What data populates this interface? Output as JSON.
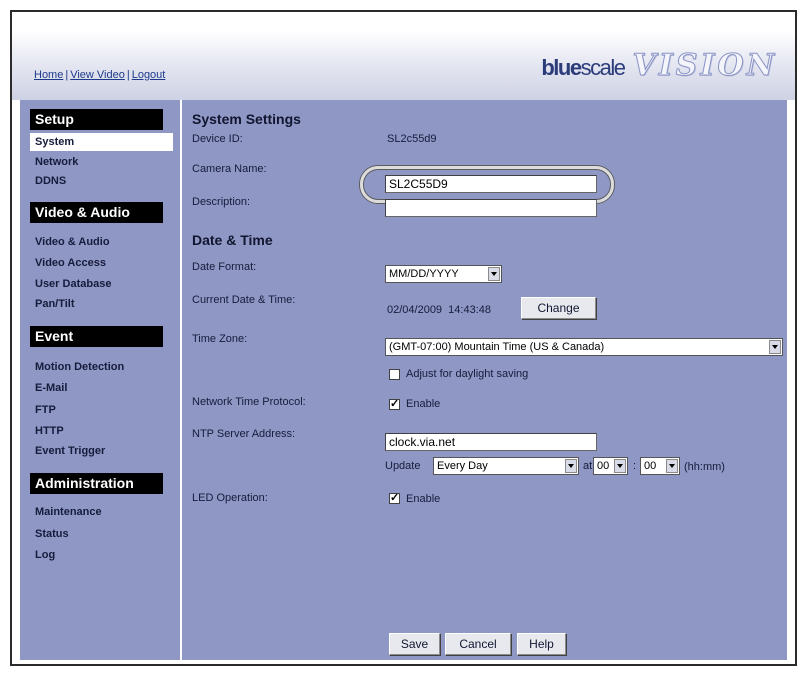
{
  "header": {
    "links": [
      "Home",
      "View Video",
      "Logout"
    ],
    "separator": "|",
    "logo": {
      "brand_bold": "blue",
      "brand_rest": "scale",
      "product": "VISION"
    }
  },
  "sidebar": {
    "sections": [
      {
        "title": "Setup",
        "items": [
          "System",
          "Network",
          "DDNS"
        ]
      },
      {
        "title": "Video & Audio",
        "items": [
          "Video & Audio",
          "Video Access",
          "User Database",
          "Pan/Tilt"
        ]
      },
      {
        "title": "Event",
        "items": [
          "Motion Detection",
          "E-Mail",
          "FTP",
          "HTTP",
          "Event Trigger"
        ]
      },
      {
        "title": "Administration",
        "items": [
          "Maintenance",
          "Status",
          "Log"
        ]
      }
    ],
    "active_item": "System"
  },
  "system": {
    "title": "System Settings",
    "device_id_label": "Device ID:",
    "device_id": "SL2c55d9",
    "camera_name_label": "Camera Name:",
    "camera_name": "SL2C55D9",
    "description_label": "Description:",
    "description": ""
  },
  "datetime": {
    "title": "Date & Time",
    "date_format_label": "Date Format:",
    "date_format": "MM/DD/YYYY",
    "current_label": "Current Date & Time:",
    "current_value": "02/04/2009  14:43:48",
    "change_button": "Change",
    "timezone_label": "Time Zone:",
    "timezone": "(GMT-07:00) Mountain Time (US & Canada)",
    "daylight_label": "Adjust for daylight saving",
    "daylight_checked": false,
    "ntp_label": "Network Time Protocol:",
    "ntp_enable_label": "Enable",
    "ntp_checked": true,
    "ntp_server_label": "NTP Server Address:",
    "ntp_server": "clock.via.net",
    "update_label": "Update",
    "update_value": "Every Day",
    "at_label": "at",
    "hour": "00",
    "time_sep": ":",
    "minute": "00",
    "time_hint": "(hh:mm)"
  },
  "led": {
    "label": "LED Operation:",
    "enable_label": "Enable",
    "checked": true
  },
  "buttons": {
    "save": "Save",
    "cancel": "Cancel",
    "help": "Help"
  },
  "colors": {
    "panel": "#8f97c5",
    "section_head": "#000000",
    "link": "#1d3a8a",
    "logo": "#2c3c7a"
  }
}
